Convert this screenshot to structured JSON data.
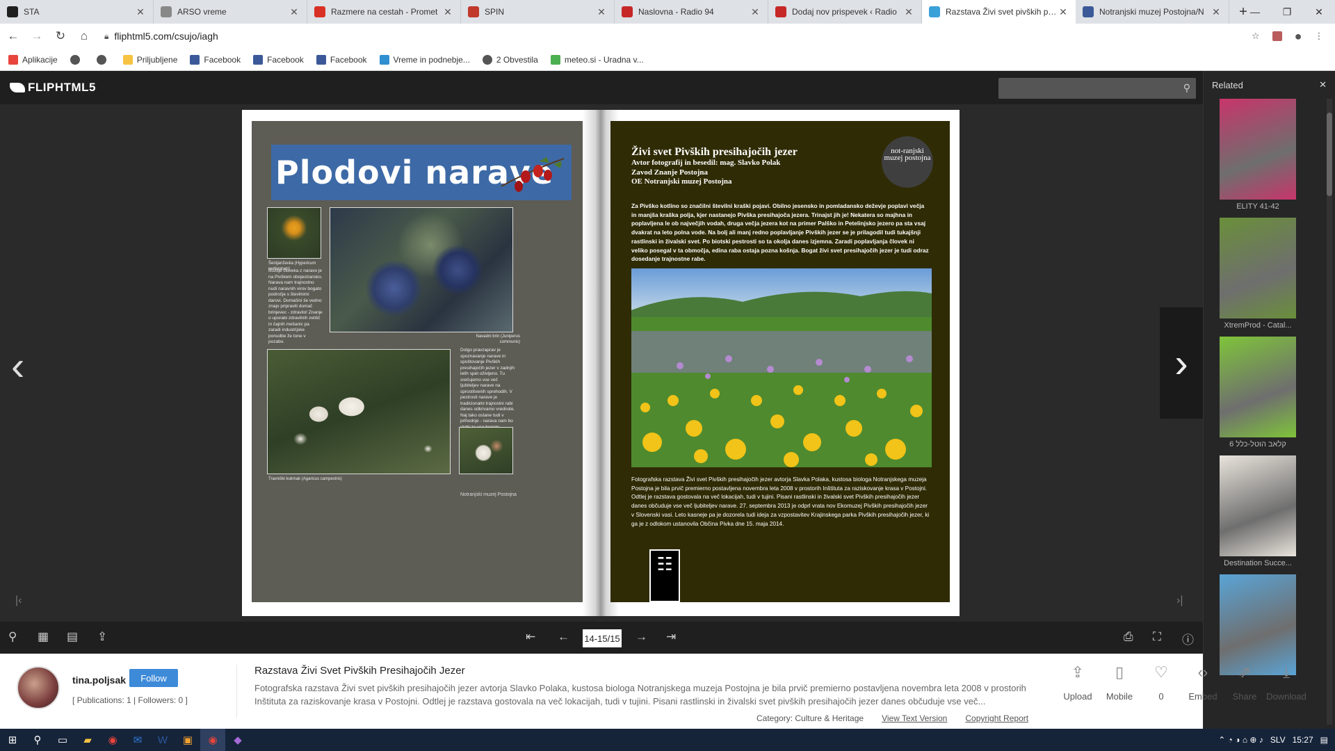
{
  "browser": {
    "tabs": [
      {
        "title": "STA",
        "favicon": "sta-icon",
        "color": "#1f1f1f",
        "active": false
      },
      {
        "title": "ARSO vreme",
        "favicon": "arso-icon",
        "color": "#888888",
        "active": false
      },
      {
        "title": "Razmere na cestah - Promet",
        "favicon": "warning-icon",
        "color": "#d93025",
        "active": false
      },
      {
        "title": "SPIN",
        "favicon": "spin-icon",
        "color": "#c0392b",
        "active": false
      },
      {
        "title": "Naslovna - Radio 94",
        "favicon": "radio94-icon",
        "color": "#c62828",
        "active": false
      },
      {
        "title": "Dodaj nov prispevek ‹ Radio",
        "favicon": "radio94-icon",
        "color": "#c62828",
        "active": false
      },
      {
        "title": "Razstava Živi svet pivških presihajočih",
        "favicon": "fliphtml5-icon",
        "color": "#3aa0d8",
        "active": true
      },
      {
        "title": "Notranjski muzej Postojna/N",
        "favicon": "facebook-icon",
        "color": "#3b5998",
        "active": false
      }
    ],
    "url": "fliphtml5.com/csujo/iagh",
    "bookmarks": [
      {
        "label": "Aplikacije",
        "icon": "apps-icon",
        "color": "#e8453c"
      },
      {
        "label": "",
        "icon": "globe-icon",
        "color": "#555555"
      },
      {
        "label": "",
        "icon": "globe-icon",
        "color": "#555555"
      },
      {
        "label": "Priljubljene",
        "icon": "folder-icon",
        "color": "#f6c343"
      },
      {
        "label": "Facebook",
        "icon": "facebook-icon",
        "color": "#3b5998"
      },
      {
        "label": "Facebook",
        "icon": "facebook-icon",
        "color": "#3b5998"
      },
      {
        "label": "Facebook",
        "icon": "facebook-icon",
        "color": "#3b5998"
      },
      {
        "label": "Vreme in podnebje...",
        "icon": "shield-icon",
        "color": "#2f8fd0"
      },
      {
        "label": "2 Obvestila",
        "icon": "globe-icon",
        "color": "#555555"
      },
      {
        "label": "meteo.si - Uradna v...",
        "icon": "meteo-icon",
        "color": "#4caf50"
      }
    ]
  },
  "viewer": {
    "logo": "FLIPHTML5",
    "search_placeholder": "",
    "page_indicator": "14-15/15",
    "related_title": "Related",
    "related": [
      {
        "caption": "ELITY 41-42",
        "color": "#c8356a"
      },
      {
        "caption": "XtremProd - Catal...",
        "color": "#6a8f3a"
      },
      {
        "caption": "קלאב הוטל-כלל 6",
        "color": "#7fc43a"
      },
      {
        "caption": "Destination Succe...",
        "color": "#e9e4dc"
      },
      {
        "caption": "",
        "color": "#5aa4d6"
      }
    ]
  },
  "book": {
    "left": {
      "banner": "Plodovi narave",
      "caption1": "Šentjanževka (Hypericum perforatum)",
      "text1": "Sožitje človeka z naravo je na Pivškem obojestransko. Narava nam trajnostno nudi naravnih virov bogato področje s številnimi darovi. Domačini še vedno znajo pripraviti domač brinjevec - zdravilo! Znanje o uporabi zdravilnih zelišč in čajnih mešanic pa zaradi industrijske ponudbe že tone v pozabo.",
      "caption2": "Navadni brin (Juniperus communis)",
      "text2": "Dolgo pravzaprav je spoznavanje narave in spoštovanje Pivških presihajočih jezer v zadnjih letih spet oživljeno. Tu srečujemo vse več ljubiteljev narave na sprostitvenih sprehodih. V pestrosti narave je tradicionalni trajnostni rabi danes odkrivamo vrednote. Naj tako ostane tudi v prihodnje - narava nam bo skrbi za vse bogato poplačala.",
      "caption3": "Travniški kukmak (Agaricus campestris)",
      "footer": "Notranjski muzej Postojna"
    },
    "right": {
      "title": "Živi svet Pivških presihajočih jezer",
      "subtitle": [
        "Avtor fotografij in besedil: mag. Slavko Polak",
        "Zavod Znanje Postojna",
        "OE Notranjski muzej Postojna"
      ],
      "logo": "not-ranjski muzej postojna",
      "intro": "Za Pivško kotlino so značilni številni kraški pojavi. Obilno jesensko in pomladansko deževje poplavi večja in manjša kraška polja, kjer nastanejo Pivška presihajoča jezera. Trinajst jih je! Nekatera so majhna in poplavljena le ob največjih vodah, druga večja jezera kot na primer Palško in Petelinjsko jezero pa sta vsaj dvakrat na leto polna vode. Na bolj ali manj redno poplavljanje Pivških jezer se je prilagodil tudi tukajšnji rastlinski in živalski svet. Po biotski pestrosti so ta okolja danes izjemna. Zaradi poplavljanja človek ni veliko posegal v ta območja, edina raba ostaja pozna košnja. Bogat živi svet presihajočih jezer je tudi odraz dosedanje trajnostne rabe.",
      "outro": "Fotografska razstava Živi svet Pivških presihajočih jezer avtorja Slavka Polaka, kustosa biologa Notranjskega muzeja Postojna je bila prvič premierno postavljena novembra leta 2008 v prostorih Inštituta za raziskovanje krasa v Postojni. Odtlej je razstava gostovala na več lokacijah, tudi v tujini. Pisani rastlinski in živalski svet Pivških presihajočih jezer danes občuduje vse več ljubiteljev narave. 27. septembra 2013 je odprl vrata nov Ekomuzej Pivških presihajočih jezer v Slovenski vasi. Leto kasneje pa je dozorela tudi ideja za vzpostavitev Krajinskega parka Pivških presihajočih jezer, ki ga je z odlokom ustanovila Občina Pivka dne 15. maja 2014."
    }
  },
  "publication": {
    "user": "tina.poljsak",
    "follow_label": "Follow",
    "stats": "[ Publications: 1 | Followers: 0 ]",
    "title": "Razstava Živi Svet Pivških Presihajočih Jezer",
    "description": "Fotografska razstava Živi svet pivških presihajočih jezer avtorja Slavko Polaka, kustosa biologa Notranjskega muzeja Postojna je bila prvič premierno postavljena novembra leta 2008 v prostorih Inštituta za raziskovanje krasa v Postojni. Odtlej je razstava gostovala na več lokacijah, tudi v tujini. Pisani rastlinski in živalski svet pivških presihajočih jezer danes občuduje vse več...",
    "category": "Category: Culture & Heritage",
    "view_text": "View Text Version",
    "copyright": "Copyright Report",
    "actions": [
      {
        "label": "Upload",
        "icon": "upload-icon",
        "glyph": "⇪"
      },
      {
        "label": "Mobile",
        "icon": "mobile-icon",
        "glyph": "▯"
      },
      {
        "label": "0",
        "icon": "heart-icon",
        "glyph": "♡"
      },
      {
        "label": "Embed",
        "icon": "embed-icon",
        "glyph": "‹›"
      },
      {
        "label": "Share",
        "icon": "share-icon",
        "glyph": "⇗"
      },
      {
        "label": "Download",
        "icon": "download-icon",
        "glyph": "⤓"
      }
    ]
  },
  "taskbar": {
    "lang": "SLV",
    "time": "15:27"
  }
}
